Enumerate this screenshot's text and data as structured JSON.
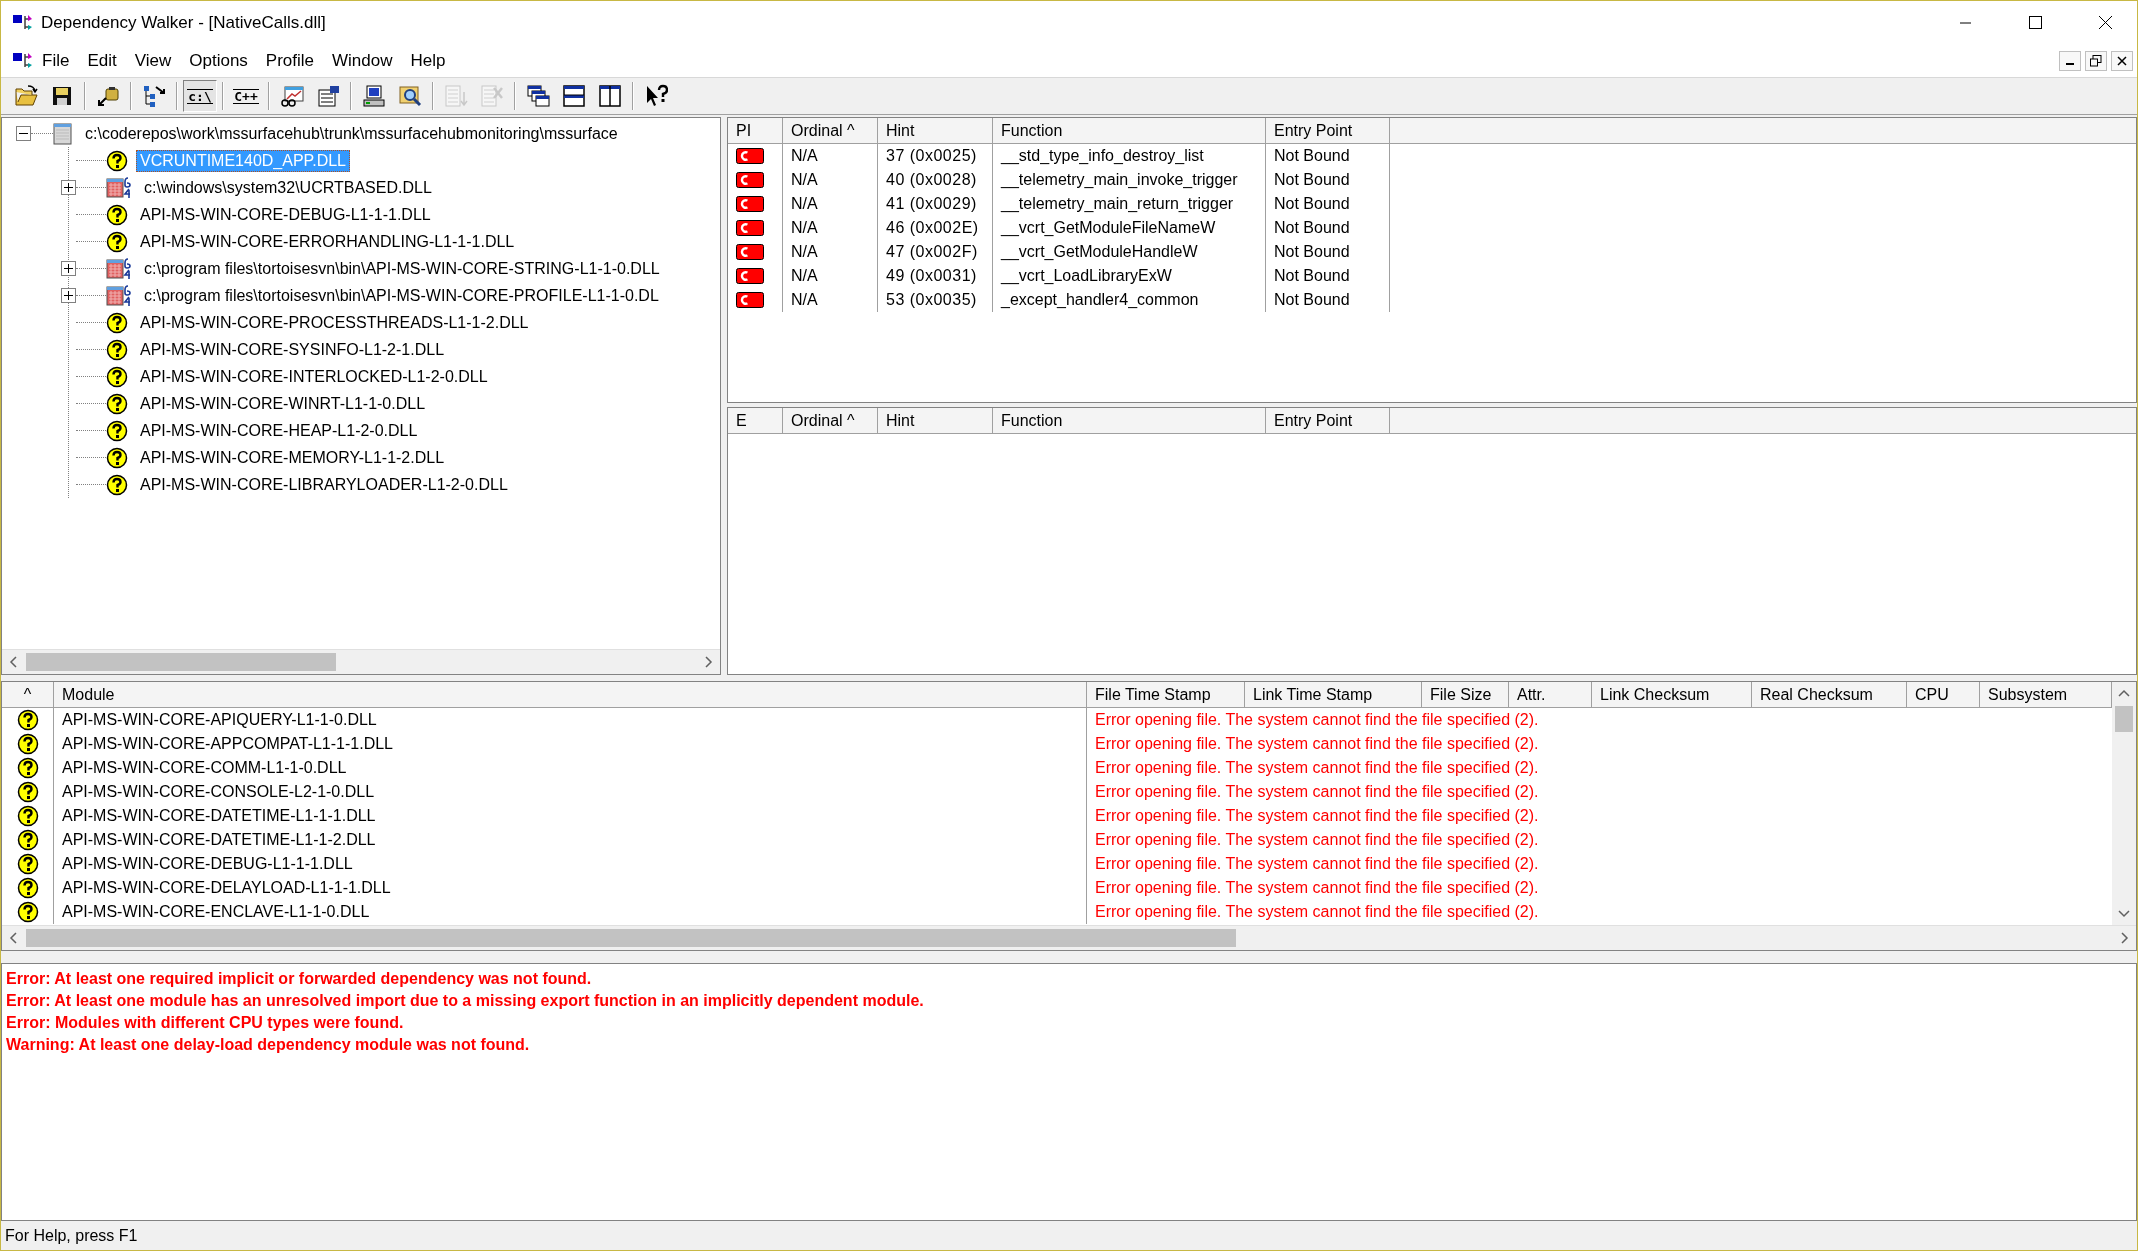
{
  "window": {
    "title": "Dependency Walker - [NativeCalls.dll]"
  },
  "menu": [
    "File",
    "Edit",
    "View",
    "Options",
    "Profile",
    "Window",
    "Help"
  ],
  "toolbar": [
    {
      "kind": "open",
      "disabled": false
    },
    {
      "kind": "save",
      "disabled": false
    },
    {
      "kind": "sep"
    },
    {
      "kind": "clipboard",
      "disabled": false
    },
    {
      "kind": "sep"
    },
    {
      "kind": "tree",
      "disabled": false
    },
    {
      "kind": "sep"
    },
    {
      "kind": "text",
      "label": "c:\\",
      "pressed": true,
      "disabled": false
    },
    {
      "kind": "sep"
    },
    {
      "kind": "text",
      "label": "C++",
      "pressed": false,
      "disabled": false
    },
    {
      "kind": "sep"
    },
    {
      "kind": "chart",
      "disabled": false
    },
    {
      "kind": "properties",
      "disabled": false
    },
    {
      "kind": "sep"
    },
    {
      "kind": "computer",
      "disabled": false
    },
    {
      "kind": "magnifier",
      "disabled": false
    },
    {
      "kind": "sep"
    },
    {
      "kind": "list",
      "disabled": true
    },
    {
      "kind": "list-x",
      "disabled": true
    },
    {
      "kind": "sep"
    },
    {
      "kind": "cascade",
      "disabled": false
    },
    {
      "kind": "tile-h",
      "disabled": false
    },
    {
      "kind": "tile-v",
      "disabled": false
    },
    {
      "kind": "sep"
    },
    {
      "kind": "help",
      "disabled": false
    }
  ],
  "tree": {
    "label": "c:\\coderepos\\work\\mssurfacehub\\trunk\\mssurfacehubmonitoring\\mssurface",
    "kind": "app",
    "expanded": true,
    "selected": false,
    "children": [
      {
        "label": "VCRUNTIME140D_APP.DLL",
        "kind": "missing",
        "selected": true
      },
      {
        "label": "c:\\windows\\system32\\UCRTBASED.DLL",
        "kind": "module64",
        "expanded": false,
        "selected": false
      },
      {
        "label": "API-MS-WIN-CORE-DEBUG-L1-1-1.DLL",
        "kind": "missing",
        "selected": false
      },
      {
        "label": "API-MS-WIN-CORE-ERRORHANDLING-L1-1-1.DLL",
        "kind": "missing",
        "selected": false
      },
      {
        "label": "c:\\program files\\tortoisesvn\\bin\\API-MS-WIN-CORE-STRING-L1-1-0.DLL",
        "kind": "module64",
        "expanded": false,
        "selected": false
      },
      {
        "label": "c:\\program files\\tortoisesvn\\bin\\API-MS-WIN-CORE-PROFILE-L1-1-0.DL",
        "kind": "module64",
        "expanded": false,
        "selected": false
      },
      {
        "label": "API-MS-WIN-CORE-PROCESSTHREADS-L1-1-2.DLL",
        "kind": "missing",
        "selected": false
      },
      {
        "label": "API-MS-WIN-CORE-SYSINFO-L1-2-1.DLL",
        "kind": "missing",
        "selected": false
      },
      {
        "label": "API-MS-WIN-CORE-INTERLOCKED-L1-2-0.DLL",
        "kind": "missing",
        "selected": false
      },
      {
        "label": "API-MS-WIN-CORE-WINRT-L1-1-0.DLL",
        "kind": "missing",
        "selected": false
      },
      {
        "label": "API-MS-WIN-CORE-HEAP-L1-2-0.DLL",
        "kind": "missing",
        "selected": false
      },
      {
        "label": "API-MS-WIN-CORE-MEMORY-L1-1-2.DLL",
        "kind": "missing",
        "selected": false
      },
      {
        "label": "API-MS-WIN-CORE-LIBRARYLOADER-L1-2-0.DLL",
        "kind": "missing",
        "selected": false
      }
    ]
  },
  "imports": {
    "columns": [
      "PI",
      "Ordinal ^",
      "Hint",
      "Function",
      "Entry Point"
    ],
    "rows": [
      {
        "kind": "c-unbound",
        "ordinal": "N/A",
        "hint": "37 (0x0025)",
        "function": "__std_type_info_destroy_list",
        "entry_point": "Not Bound"
      },
      {
        "kind": "c-unbound",
        "ordinal": "N/A",
        "hint": "40 (0x0028)",
        "function": "__telemetry_main_invoke_trigger",
        "entry_point": "Not Bound"
      },
      {
        "kind": "c-unbound",
        "ordinal": "N/A",
        "hint": "41 (0x0029)",
        "function": "__telemetry_main_return_trigger",
        "entry_point": "Not Bound"
      },
      {
        "kind": "c-unbound",
        "ordinal": "N/A",
        "hint": "46 (0x002E)",
        "function": "__vcrt_GetModuleFileNameW",
        "entry_point": "Not Bound"
      },
      {
        "kind": "c-unbound",
        "ordinal": "N/A",
        "hint": "47 (0x002F)",
        "function": "__vcrt_GetModuleHandleW",
        "entry_point": "Not Bound"
      },
      {
        "kind": "c-unbound",
        "ordinal": "N/A",
        "hint": "49 (0x0031)",
        "function": "__vcrt_LoadLibraryExW",
        "entry_point": "Not Bound"
      },
      {
        "kind": "c-unbound",
        "ordinal": "N/A",
        "hint": "53 (0x0035)",
        "function": "_except_handler4_common",
        "entry_point": "Not Bound"
      }
    ]
  },
  "exports": {
    "columns": [
      "E",
      "Ordinal ^",
      "Hint",
      "Function",
      "Entry Point"
    ]
  },
  "modules": {
    "columns": [
      "^",
      "Module",
      "File Time Stamp",
      "Link Time Stamp",
      "File Size",
      "Attr.",
      "Link Checksum",
      "Real Checksum",
      "CPU",
      "Subsystem"
    ],
    "rows": [
      {
        "kind": "missing",
        "module": "API-MS-WIN-CORE-APIQUERY-L1-1-0.DLL",
        "error": "Error opening file. The system cannot find the file specified (2)."
      },
      {
        "kind": "missing",
        "module": "API-MS-WIN-CORE-APPCOMPAT-L1-1-1.DLL",
        "error": "Error opening file. The system cannot find the file specified (2)."
      },
      {
        "kind": "missing",
        "module": "API-MS-WIN-CORE-COMM-L1-1-0.DLL",
        "error": "Error opening file. The system cannot find the file specified (2)."
      },
      {
        "kind": "missing",
        "module": "API-MS-WIN-CORE-CONSOLE-L2-1-0.DLL",
        "error": "Error opening file. The system cannot find the file specified (2)."
      },
      {
        "kind": "missing",
        "module": "API-MS-WIN-CORE-DATETIME-L1-1-1.DLL",
        "error": "Error opening file. The system cannot find the file specified (2)."
      },
      {
        "kind": "missing",
        "module": "API-MS-WIN-CORE-DATETIME-L1-1-2.DLL",
        "error": "Error opening file. The system cannot find the file specified (2)."
      },
      {
        "kind": "missing",
        "module": "API-MS-WIN-CORE-DEBUG-L1-1-1.DLL",
        "error": "Error opening file. The system cannot find the file specified (2)."
      },
      {
        "kind": "missing",
        "module": "API-MS-WIN-CORE-DELAYLOAD-L1-1-1.DLL",
        "error": "Error opening file. The system cannot find the file specified (2)."
      },
      {
        "kind": "missing",
        "module": "API-MS-WIN-CORE-ENCLAVE-L1-1-0.DLL",
        "error": "Error opening file. The system cannot find the file specified (2)."
      }
    ]
  },
  "log": [
    "Error: At least one required implicit or forwarded dependency was not found.",
    "Error: At least one module has an unresolved import due to a missing export function in an implicitly dependent module.",
    "Error: Modules with different CPU types were found.",
    "Warning: At least one delay-load dependency module was not found."
  ],
  "status_bar": "For Help, press F1"
}
